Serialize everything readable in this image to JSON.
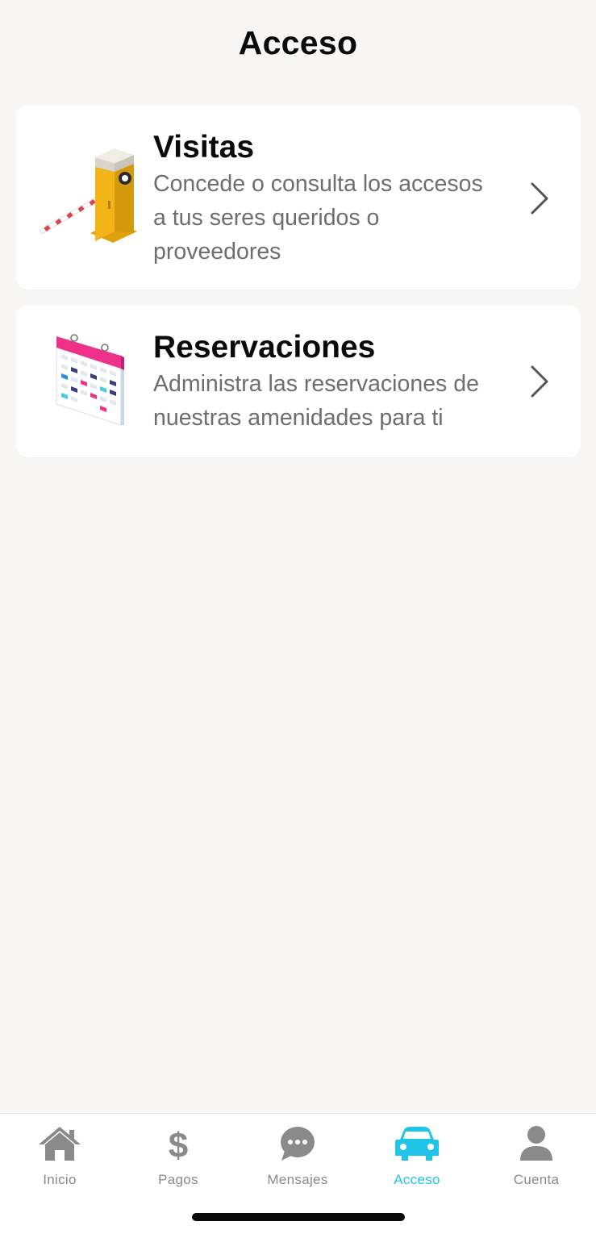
{
  "header": {
    "title": "Acceso"
  },
  "cards": [
    {
      "title": "Visitas",
      "description_lines": [
        "Concede o consulta los accesos",
        "a tus seres queridos o",
        "proveedores"
      ],
      "icon": "barrier-gate-illustration"
    },
    {
      "title": "Reservaciones",
      "description_lines": [
        "Administra las reservaciones de",
        "nuestras amenidades para ti"
      ],
      "icon": "calendar-illustration"
    }
  ],
  "tabbar": {
    "tabs": [
      {
        "label": "Inicio",
        "icon": "home-icon",
        "active": false
      },
      {
        "label": "Pagos",
        "icon": "dollar-icon",
        "active": false
      },
      {
        "label": "Mensajes",
        "icon": "chat-bubble-icon",
        "active": false
      },
      {
        "label": "Acceso",
        "icon": "car-icon",
        "active": true
      },
      {
        "label": "Cuenta",
        "icon": "user-icon",
        "active": false
      }
    ]
  },
  "colors": {
    "background": "#f8f7f6",
    "card": "#ffffff",
    "accent": "#1fc4e6",
    "inactive": "#8a8a8a",
    "text_secondary": "#6e6e6e"
  }
}
